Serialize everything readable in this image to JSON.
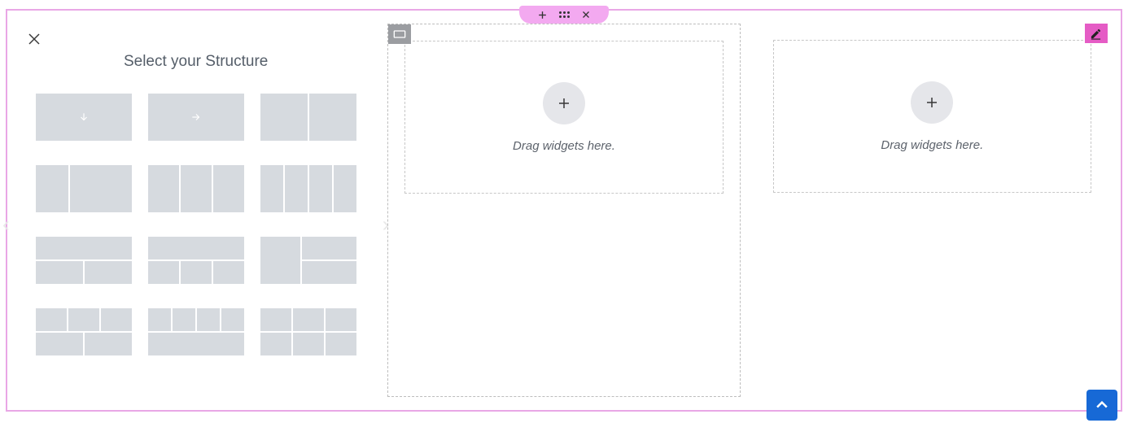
{
  "section_tab": {
    "add": "add-section",
    "drag": "drag-section",
    "close": "remove-section"
  },
  "structure_panel": {
    "title": "Select your Structure",
    "close_label": "close",
    "nav_prev": "‹",
    "nav_next": "›"
  },
  "dropzones": {
    "placeholder": "Drag widgets here."
  },
  "scroll_top": {
    "label": "scroll-to-top"
  }
}
